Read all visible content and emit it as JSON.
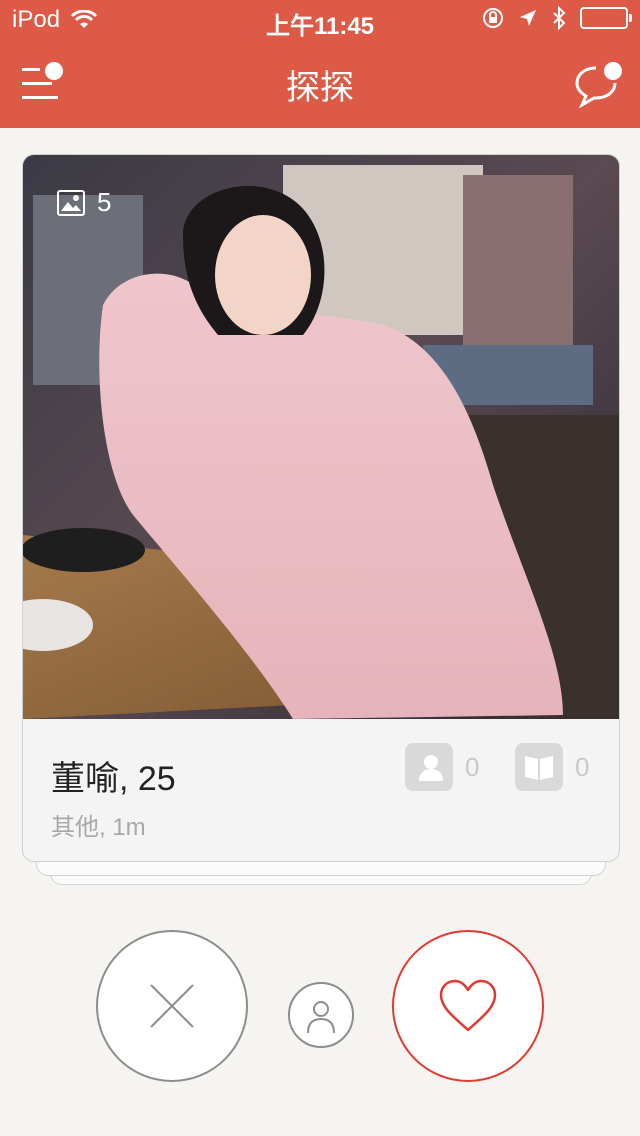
{
  "status_bar": {
    "carrier": "iPod",
    "time": "上午11:45"
  },
  "nav": {
    "title": "探探"
  },
  "card": {
    "photo_count": "5",
    "name_age": "董喻, 25",
    "subtitle": "其他, 1m",
    "friends_count": "0",
    "moments_count": "0"
  },
  "colors": {
    "brand": "#dc5a46",
    "like": "#e23a2f",
    "neutral": "#8d8d8d"
  },
  "icons": {
    "menu": "menu-notification-icon",
    "chat": "chat-bubble-icon",
    "photo": "photo-icon",
    "friends": "person-icon",
    "moments": "book-icon",
    "nope": "close-icon",
    "profile": "user-icon",
    "like": "heart-icon"
  }
}
